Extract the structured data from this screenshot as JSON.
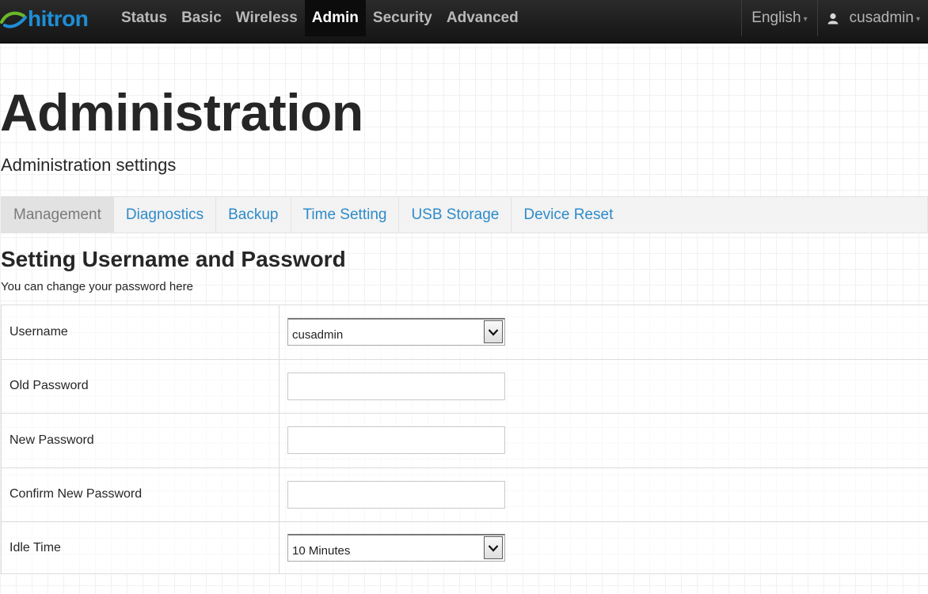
{
  "brand": {
    "logo_text": "hitron"
  },
  "nav": {
    "items": [
      {
        "label": "Status"
      },
      {
        "label": "Basic"
      },
      {
        "label": "Wireless"
      },
      {
        "label": "Admin",
        "active": true
      },
      {
        "label": "Security"
      },
      {
        "label": "Advanced"
      }
    ],
    "language": "English",
    "user": "cusadmin"
  },
  "header": {
    "title": "Administration",
    "subtitle": "Administration settings"
  },
  "tabs": [
    {
      "label": "Management",
      "active": true
    },
    {
      "label": "Diagnostics"
    },
    {
      "label": "Backup"
    },
    {
      "label": "Time Setting"
    },
    {
      "label": "USB Storage"
    },
    {
      "label": "Device Reset"
    }
  ],
  "section": {
    "title": "Setting Username and Password",
    "description": "You can change your password here"
  },
  "form": {
    "username": {
      "label": "Username",
      "value": "cusadmin"
    },
    "old_password": {
      "label": "Old Password",
      "value": ""
    },
    "new_password": {
      "label": "New Password",
      "value": ""
    },
    "confirm_password": {
      "label": "Confirm New Password",
      "value": ""
    },
    "idle_time": {
      "label": "Idle Time",
      "value": "10 Minutes"
    }
  },
  "colors": {
    "nav_bg": "#1c1c1c",
    "brand_blue": "#1d8fd6",
    "link_blue": "#2d8bc9",
    "tab_bg": "#f3f3f3"
  }
}
